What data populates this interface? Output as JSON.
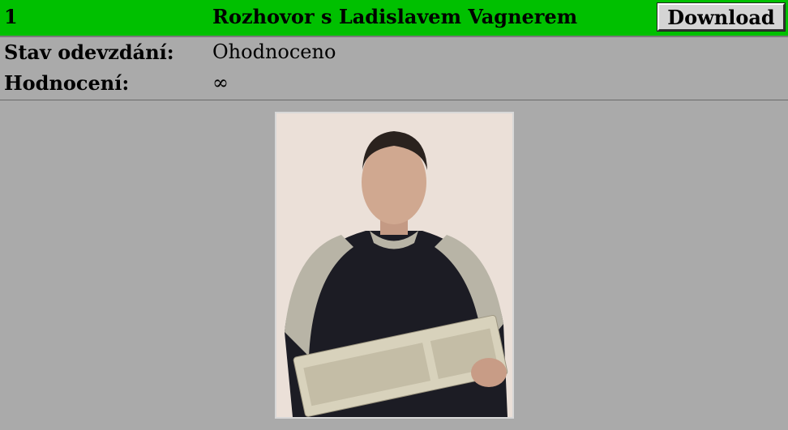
{
  "header": {
    "number": "1",
    "title": "Rozhovor s Ladislavem Vagnerem",
    "download_label": "Download"
  },
  "details": [
    {
      "label": "Stav odevzdání:",
      "value": "Ohodnoceno"
    },
    {
      "label": "Hodnocení:",
      "value": "∞"
    }
  ],
  "colors": {
    "header_bg": "#00c000",
    "page_bg": "#aaaaaa"
  }
}
